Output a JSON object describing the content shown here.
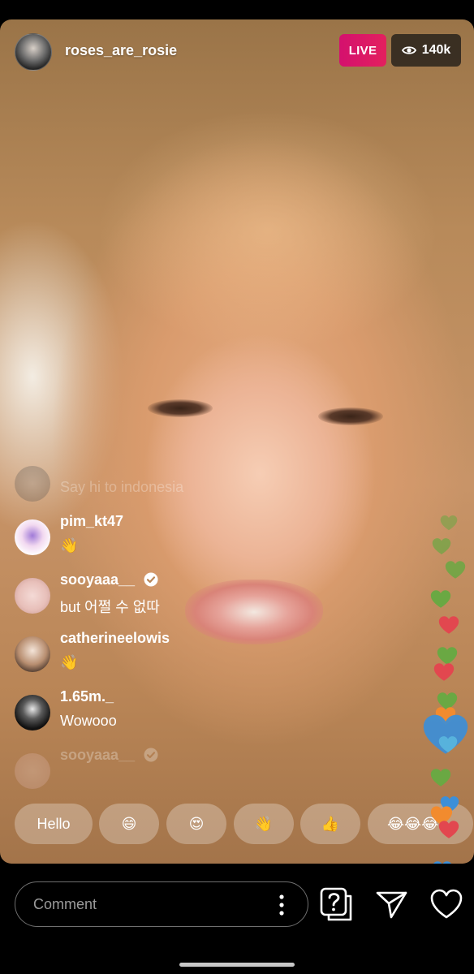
{
  "header": {
    "username": "roses_are_rosie",
    "live_label": "LIVE",
    "viewer_count": "140k"
  },
  "comments": [
    {
      "username": "",
      "text": "Say hi to indonesia",
      "faded": true
    },
    {
      "username": "pim_kt47",
      "text": "👋",
      "verified": false
    },
    {
      "username": "sooyaaa__",
      "text": "but 어쩔 수 없따",
      "verified": true
    },
    {
      "username": "catherineelowis",
      "text": "👋",
      "verified": false
    },
    {
      "username": "1.65m._",
      "text": "Wowooo",
      "verified": false
    },
    {
      "username": "sooyaaa__",
      "text": "",
      "verified": true,
      "faded": true
    }
  ],
  "quick_replies": [
    "Hello",
    "😄",
    "😍",
    "👋",
    "👍",
    "😂😂😂"
  ],
  "bottom_bar": {
    "comment_placeholder": "Comment",
    "icons": [
      "more-options-icon",
      "question-icon",
      "send-icon",
      "heart-icon"
    ]
  },
  "colors": {
    "live": "#e3205e",
    "heart_green": "#6aa843",
    "heart_red": "#e2474f",
    "heart_blue": "#3c8fd8",
    "heart_orange": "#f28b2e"
  }
}
